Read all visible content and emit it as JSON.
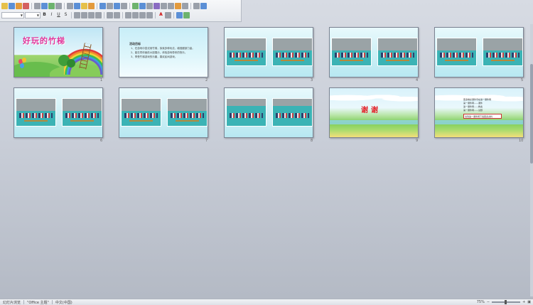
{
  "toolbar": {
    "font_name": "",
    "font_size": "",
    "bold": "B",
    "italic": "I",
    "underline": "U",
    "strike": "S",
    "font_color": "A"
  },
  "slides": [
    {
      "num": "1",
      "title": "好玩的竹梯"
    },
    {
      "num": "2",
      "heading": "活动目标",
      "lines": [
        "1、在游戏中尝试用竹梯，探索多种玩法，增强腿部力量。",
        "2、能在同伴面前大胆展示，体验游戏带来的快乐。",
        "3、享受竹梯游戏的乐趣，喜欢民间游戏。"
      ]
    },
    {
      "num": "3"
    },
    {
      "num": "4"
    },
    {
      "num": "5"
    },
    {
      "num": "6"
    },
    {
      "num": "7"
    },
    {
      "num": "8"
    },
    {
      "num": "9",
      "thanks": "谢谢"
    },
    {
      "num": "10",
      "lines": [
        "更多精彩课件尽在第一课件网",
        "第一课件网——课件",
        "第一课件网——教案",
        "第一课件网——试题"
      ],
      "box": "请到第一课件网下载更多资料"
    }
  ],
  "status": {
    "view": "幻灯片浏览",
    "theme": "\"Office 主题\"",
    "language": "中文(中国)",
    "zoom": "75%"
  },
  "colors": {
    "title_pink": "#e0359b",
    "thanks_red": "#e3222a",
    "teal_ground": "#3bb3b5"
  }
}
